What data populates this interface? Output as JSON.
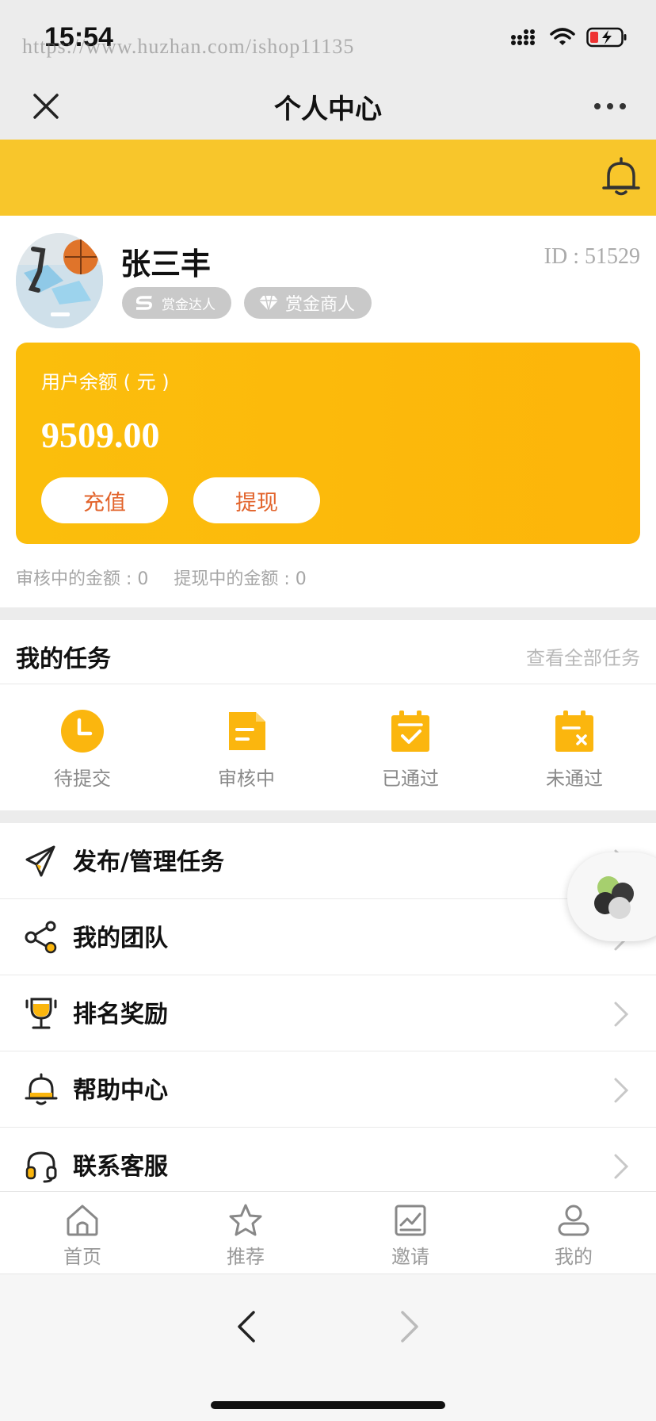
{
  "status_bar": {
    "time": "15:54",
    "watermark": "https://www.huzhan.com/ishop11135"
  },
  "nav": {
    "title": "个人中心"
  },
  "profile": {
    "name": "张三丰",
    "id_text": "ID : 51529",
    "badges": [
      "赏金达人",
      "赏金商人"
    ]
  },
  "balance": {
    "label": "用户余额 ( 元 )",
    "amount": "9509.00",
    "recharge_label": "充值",
    "withdraw_label": "提现"
  },
  "pending": {
    "review_amount": "审核中的金额 : 0",
    "withdraw_amount": "提现中的金额 : 0"
  },
  "tasks": {
    "title": "我的任务",
    "view_all": "查看全部任务",
    "items": [
      {
        "label": "待提交",
        "icon": "clock-icon"
      },
      {
        "label": "审核中",
        "icon": "document-icon"
      },
      {
        "label": "已通过",
        "icon": "check-clipboard-icon"
      },
      {
        "label": "未通过",
        "icon": "x-clipboard-icon"
      }
    ]
  },
  "menu": [
    {
      "label": "发布/管理任务",
      "icon": "paper-plane-icon"
    },
    {
      "label": "我的团队",
      "icon": "share-icon"
    },
    {
      "label": "排名奖励",
      "icon": "trophy-icon"
    },
    {
      "label": "帮助中心",
      "icon": "help-bell-icon"
    },
    {
      "label": "联系客服",
      "icon": "headset-icon"
    }
  ],
  "tabbar": [
    {
      "label": "首页",
      "icon": "home-icon"
    },
    {
      "label": "推荐",
      "icon": "star-icon"
    },
    {
      "label": "邀请",
      "icon": "chart-icon"
    },
    {
      "label": "我的",
      "icon": "user-icon"
    }
  ],
  "colors": {
    "accent_yellow": "#f8c62b",
    "card_orange": "#fbbe0c",
    "button_text": "#e2632b",
    "muted_text": "#a6a6a6"
  }
}
